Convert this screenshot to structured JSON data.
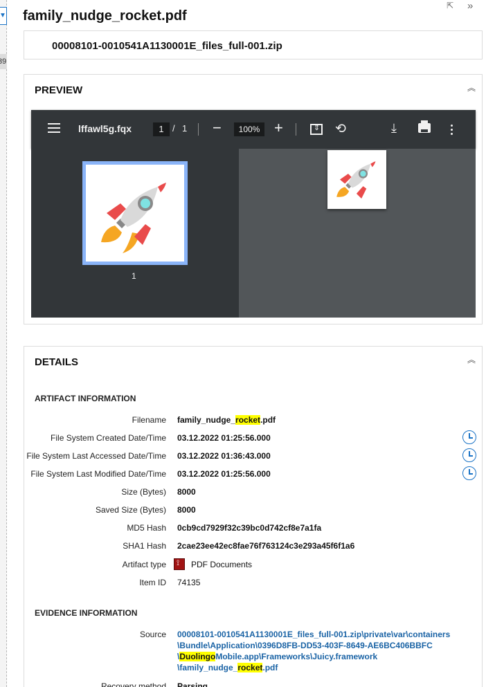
{
  "header": {
    "file_title": "family_nudge_rocket.pdf",
    "container_path": "00008101-0010541A1130001E_files_full-001.zip"
  },
  "left_panel": {
    "selected_fragment": "39"
  },
  "preview": {
    "title": "PREVIEW",
    "viewer": {
      "doc_title": "lffawl5g.fqx",
      "current_page": "1",
      "page_separator": "/",
      "total_pages": "1",
      "zoom": "100%",
      "thumbnail_label": "1"
    }
  },
  "details": {
    "title": "DETAILS",
    "artifact_section": "ARTIFACT INFORMATION",
    "filename_label": "Filename",
    "filename_pre": "family_nudge_",
    "filename_hl": "rocket",
    "filename_post": ".pdf",
    "rows": [
      {
        "label": "File System Created Date/Time",
        "value": "03.12.2022 01:25:56.000"
      },
      {
        "label": "File System Last Accessed Date/Time",
        "value": "03.12.2022 01:36:43.000"
      },
      {
        "label": "File System Last Modified Date/Time",
        "value": "03.12.2022 01:25:56.000"
      },
      {
        "label": "Size (Bytes)",
        "value": "8000"
      },
      {
        "label": "Saved Size (Bytes)",
        "value": "8000"
      },
      {
        "label": "MD5 Hash",
        "value": "0cb9cd7929f32c39bc0d742cf8e7a1fa"
      },
      {
        "label": "SHA1 Hash",
        "value": "2cae23ee42ec8fae76f763124c3e293a45f6f1a6"
      }
    ],
    "artifact_type_label": "Artifact type",
    "artifact_type_value": "PDF Documents",
    "item_id_label": "Item ID",
    "item_id_value": "74135",
    "evidence_section": "EVIDENCE INFORMATION",
    "source_label": "Source",
    "source_line1": "00008101-0010541A1130001E_files_full-001.zip\\private\\var\\containers",
    "source_line2": "\\Bundle\\Application\\0396D8FB-DD53-403F-8649-AE6BC406BBFC",
    "source_line3_pre": "\\",
    "source_line3_hl": "Duolingo",
    "source_line3_post": "Mobile.app\\Frameworks\\Juicy.framework",
    "source_line4_pre": "\\family_nudge_",
    "source_line4_hl": "rocket",
    "source_line4_post": ".pdf",
    "recovery_label": "Recovery method",
    "recovery_value": "Parsing"
  },
  "colors": {
    "accent": "#1a73c6",
    "link": "#1a63a5",
    "highlight": "#ffff00",
    "viewer_dark": "#323639",
    "viewer_page_bg": "#525659",
    "thumb_border": "#8ab4f8"
  }
}
